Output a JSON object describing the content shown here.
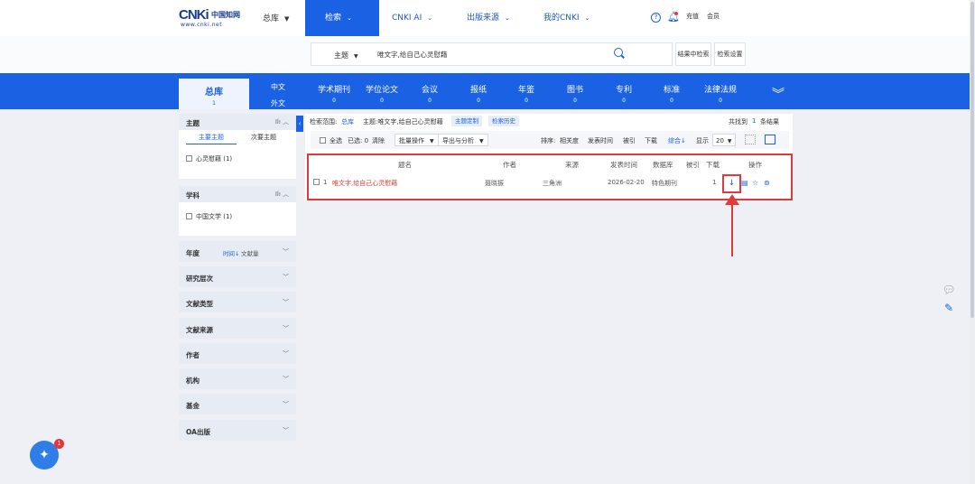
{
  "logo": {
    "main": "CNKi",
    "cn": "中国知网",
    "sub": "www.cnki.net"
  },
  "header": {
    "db_select": "总库",
    "nav": [
      {
        "label": "检索"
      },
      {
        "label": "CNKI AI"
      },
      {
        "label": "出版来源"
      },
      {
        "label": "我的CNKI"
      }
    ],
    "help": "?",
    "recharge": "充值",
    "member": "会员"
  },
  "search": {
    "field": "主题",
    "query": "唯文字,给自己心灵慰藉",
    "in_results": "结果中检索",
    "settings": "检索设置"
  },
  "categories": {
    "active": {
      "label": "总库",
      "count": "1"
    },
    "lang_cn": "中文",
    "lang_foreign": "外文",
    "items": [
      {
        "label": "学术期刊",
        "count": "0"
      },
      {
        "label": "学位论文",
        "count": "0"
      },
      {
        "label": "会议",
        "count": "0"
      },
      {
        "label": "报纸",
        "count": "0"
      },
      {
        "label": "年鉴",
        "count": "0"
      },
      {
        "label": "图书",
        "count": "0"
      },
      {
        "label": "专利",
        "count": "0"
      },
      {
        "label": "标准",
        "count": "0"
      },
      {
        "label": "法律法规",
        "count": "0"
      }
    ]
  },
  "sidebar": {
    "topic": {
      "title": "主题",
      "tab_main": "主要主题",
      "tab_sub": "次要主题",
      "item": "心灵慰藉 (1)"
    },
    "subject": {
      "title": "学科",
      "item": "中国文学 (1)"
    },
    "year": {
      "title": "年度",
      "sort_time": "时间↓",
      "sort_count": "文献量"
    },
    "groups": [
      "研究层次",
      "文献类型",
      "文献来源",
      "作者",
      "机构",
      "基金",
      "OA出版"
    ]
  },
  "results": {
    "scope_label": "检索范围:",
    "scope_value": "总库",
    "topic_text": "主题:唯文字,给自己心灵慰藉",
    "chip_custom": "主题定制",
    "chip_history": "检索历史",
    "found_pre": "共找到",
    "found_count": "1",
    "found_post": "条结果",
    "select_all": "全选",
    "selected": "已选: 0",
    "clear": "清除",
    "batch": "批量操作",
    "export": "导出与分析",
    "sort_label": "排序:",
    "sort_relevance": "相关度",
    "sort_date": "发表时间",
    "sort_cited": "被引",
    "sort_download": "下载",
    "sort_composite": "综合↓",
    "display_label": "显示",
    "page_size": "20",
    "headers": {
      "title": "题名",
      "author": "作者",
      "source": "来源",
      "date": "发表时间",
      "database": "数据库",
      "cited": "被引",
      "downloads": "下载",
      "ops": "操作"
    },
    "row": {
      "index": "1",
      "title": "唯文字,给自己心灵慰藉",
      "author": "聂晓振",
      "source": "三角洲",
      "date": "2026-02-20",
      "database": "特色期刊",
      "cited": "",
      "downloads": "1"
    }
  },
  "assistant": {
    "badge": "1"
  },
  "accent": "#1a62e3",
  "highlight": "#e23a3a"
}
